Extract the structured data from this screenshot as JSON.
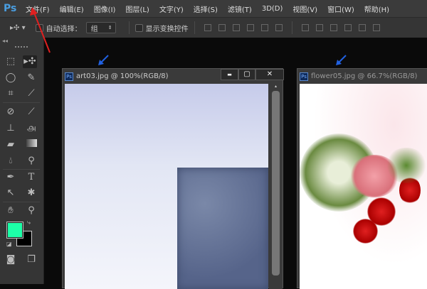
{
  "app": {
    "logo": "Ps"
  },
  "menu": [
    "文件(F)",
    "编辑(E)",
    "图像(I)",
    "图层(L)",
    "文字(Y)",
    "选择(S)",
    "滤镜(T)",
    "3D(D)",
    "视图(V)",
    "窗口(W)",
    "帮助(H)"
  ],
  "options": {
    "auto_select_label": "自动选择：",
    "auto_select_value": "组",
    "show_transform_label": "显示变换控件"
  },
  "tools": [
    "rectangular-marquee",
    "move",
    "lasso",
    "quick-selection",
    "crop",
    "eyedropper",
    "spot-healing",
    "brush",
    "clone-stamp",
    "history-brush",
    "eraser",
    "gradient",
    "blur",
    "dodge",
    "pen",
    "type",
    "path-selection",
    "custom-shape",
    "hand",
    "zoom"
  ],
  "colors": {
    "foreground": "#1dffa8",
    "background": "#000000",
    "accent_arrow_red": "#e02020",
    "accent_arrow_blue": "#2060e0"
  },
  "documents": [
    {
      "title": "art03.jpg @ 100%(RGB/8)"
    },
    {
      "title": "flower05.jpg @ 66.7%(RGB/8)"
    }
  ],
  "window_buttons": {
    "minimize": "▬",
    "maximize": "▢",
    "close": "✕"
  }
}
